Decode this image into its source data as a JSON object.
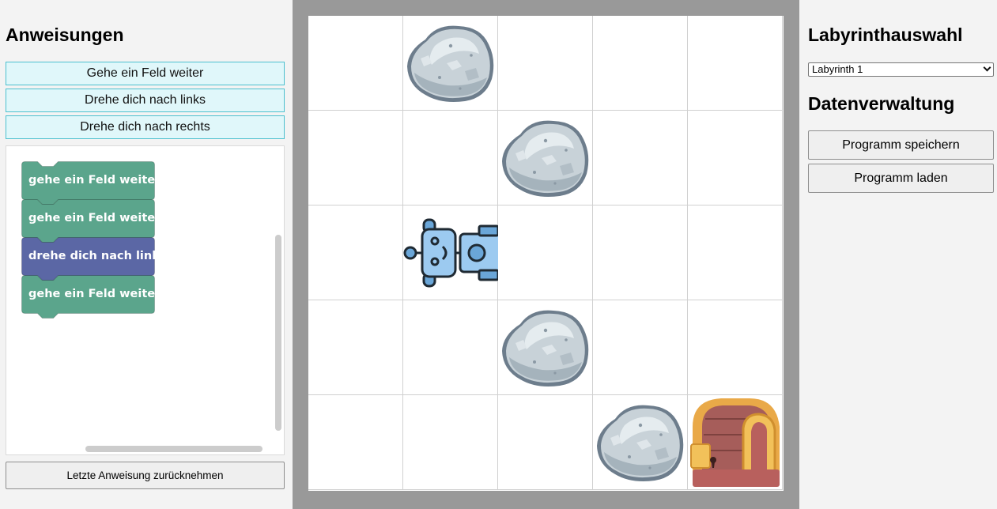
{
  "left_panel": {
    "title": "Anweisungen",
    "instructions": [
      {
        "label": "Gehe ein Feld weiter"
      },
      {
        "label": "Drehe dich nach links"
      },
      {
        "label": "Drehe dich nach rechts"
      }
    ],
    "program_blocks": [
      {
        "label": "gehe ein Feld weiter",
        "color": "#5ba58c"
      },
      {
        "label": "gehe ein Feld weiter",
        "color": "#5ba58c"
      },
      {
        "label": "drehe dich nach links",
        "color": "#5b67a5"
      },
      {
        "label": "gehe ein Feld weiter",
        "color": "#5ba58c"
      }
    ],
    "undo_label": "Letzte Anweisung zurücknehmen"
  },
  "board": {
    "rows": 5,
    "cols": 5,
    "cells": [
      [
        "empty",
        "rock",
        "empty",
        "empty",
        "empty"
      ],
      [
        "empty",
        "empty",
        "rock",
        "empty",
        "empty"
      ],
      [
        "empty",
        "robot",
        "empty",
        "empty",
        "empty"
      ],
      [
        "empty",
        "empty",
        "rock",
        "empty",
        "empty"
      ],
      [
        "empty",
        "empty",
        "empty",
        "rock",
        "treasure-chest"
      ]
    ],
    "robot_facing": "right"
  },
  "right_panel": {
    "maze_title": "Labyrinthauswahl",
    "maze_selected": "Labyrinth 1",
    "data_title": "Datenverwaltung",
    "save_label": "Programm speichern",
    "load_label": "Programm laden"
  },
  "colors": {
    "move_block": "#5ba58c",
    "turn_block": "#5b67a5",
    "instruction_bg": "#e0f7fa",
    "instruction_border": "#4dc0cf",
    "board_frame": "#999999"
  }
}
